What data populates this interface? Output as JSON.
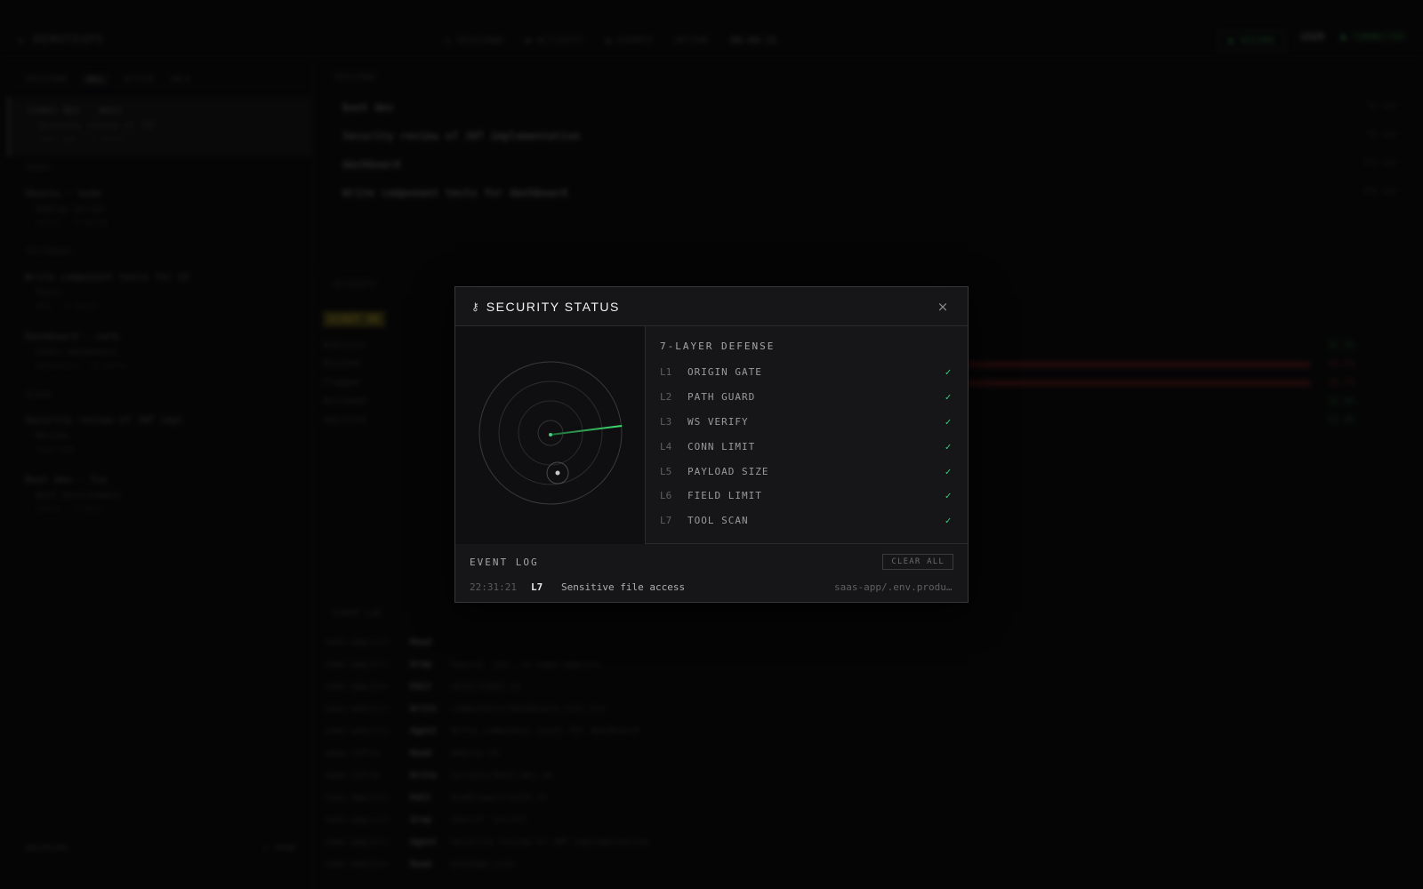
{
  "background": {
    "brand": "▸ REMOTEOPS",
    "nav": [
      "◎ SESSIONS",
      "◉ ACTIVITY",
      "▤ EVENTS"
    ],
    "time_label": "UPTIME",
    "time_value": "00:00:21",
    "status_pill": "◉ SECURE",
    "status_user": "USER",
    "connection": "● CONNECTED",
    "sidebar_tabs": [
      "SESSIONS",
      "ALL",
      "ACTIVE",
      "IDLE"
    ],
    "sidebar_groups": [
      "TODAY",
      "YESTERDAY",
      "OLDER"
    ],
    "sidebar_items": [
      {
        "title": "Codex Ops · main",
        "sub": "Security review of JWT",
        "meta": "saas-app · 3 turns"
      },
      {
        "title": "Ubuntu · node",
        "sub": "Deploy script",
        "meta": "infra · 2 turns"
      },
      {
        "title": "Write component tests for UI",
        "sub": "Tests",
        "meta": "web · 4 turns"
      },
      {
        "title": "Dashboard · cafe",
        "sub": "Stats dashboard",
        "meta": "analytics · 5 turns"
      },
      {
        "title": "Security review of JWT impl",
        "sub": "Review",
        "meta": "saas-app"
      },
      {
        "title": "Boot dev · fix",
        "sub": "Boot environment",
        "meta": "infra · 1 turn"
      }
    ],
    "sidebar_footer_left": "ARCHIVED",
    "sidebar_footer_right": "▸ SHOW",
    "sessions_head": "SESSIONS",
    "sessions": [
      {
        "title": "boot dev",
        "date": "2m ago"
      },
      {
        "title": "Security review of JWT implementation",
        "date": "5m ago"
      },
      {
        "title": "dashboard",
        "date": "12m ago"
      },
      {
        "title": "Write component tests for dashboard",
        "date": "20m ago"
      }
    ],
    "panel2_head": "ACTIVITY",
    "highlight": "SCOUT OK",
    "bars": [
      {
        "label": "Analysis",
        "value": "32.3%",
        "color": "g"
      },
      {
        "label": "Blocked",
        "value": "19.2%",
        "color": "r"
      },
      {
        "label": "Flagged",
        "value": "18.7%",
        "color": "r"
      },
      {
        "label": "Reviewed",
        "value": "12.5%",
        "color": "g"
      },
      {
        "label": "Approved",
        "value": "11.3%",
        "color": "g"
      }
    ],
    "log_head": "EVENT LOG",
    "log_rows": [
      {
        "src": "saas-app/src",
        "k": "Read",
        "msg": ""
      },
      {
        "src": "saas-app/src",
        "k": "Grep",
        "msg": "Search 'jwt' in saas-app/src"
      },
      {
        "src": "saas-app/src",
        "k": "Edit",
        "msg": "auth/token.ts"
      },
      {
        "src": "saas-web/src",
        "k": "Write",
        "msg": "components/Dashboard.test.tsx"
      },
      {
        "src": "saas-web/src",
        "k": "Agent",
        "msg": "Write component tests for dashboard"
      },
      {
        "src": "saas-infra",
        "k": "Read",
        "msg": "deploy.sh"
      },
      {
        "src": "saas-infra",
        "k": "Write",
        "msg": "scripts/boot-dev.sh"
      },
      {
        "src": "saas-app/src",
        "k": "Edit",
        "msg": "middleware/auth.ts"
      },
      {
        "src": "saas-app/src",
        "k": "Grep",
        "msg": "Search 'secret'"
      },
      {
        "src": "saas-app/src",
        "k": "Agent",
        "msg": "Security review of JWT implementation"
      },
      {
        "src": "saas-web/src",
        "k": "Read",
        "msg": "package.json"
      }
    ]
  },
  "modal": {
    "key_icon": "⚷",
    "title": "SECURITY STATUS",
    "close_icon": "×",
    "defense_title": "7-LAYER DEFENSE",
    "check_icon": "✓",
    "layers": [
      {
        "id": "L1",
        "name": "ORIGIN GATE"
      },
      {
        "id": "L2",
        "name": "PATH GUARD"
      },
      {
        "id": "L3",
        "name": "WS VERIFY"
      },
      {
        "id": "L4",
        "name": "CONN LIMIT"
      },
      {
        "id": "L5",
        "name": "PAYLOAD SIZE"
      },
      {
        "id": "L6",
        "name": "FIELD LIMIT"
      },
      {
        "id": "L7",
        "name": "TOOL SCAN"
      }
    ],
    "event_log_title": "EVENT LOG",
    "clear_all_label": "CLEAR ALL",
    "events": [
      {
        "time": "22:31:21",
        "layer": "L7",
        "message": "Sensitive file access",
        "path": "saas-app/.env.produ…"
      }
    ]
  },
  "colors": {
    "ok_green": "#3fcf7f",
    "radar_sweep": "#2fbf5a",
    "modal_bg": "#161618"
  }
}
